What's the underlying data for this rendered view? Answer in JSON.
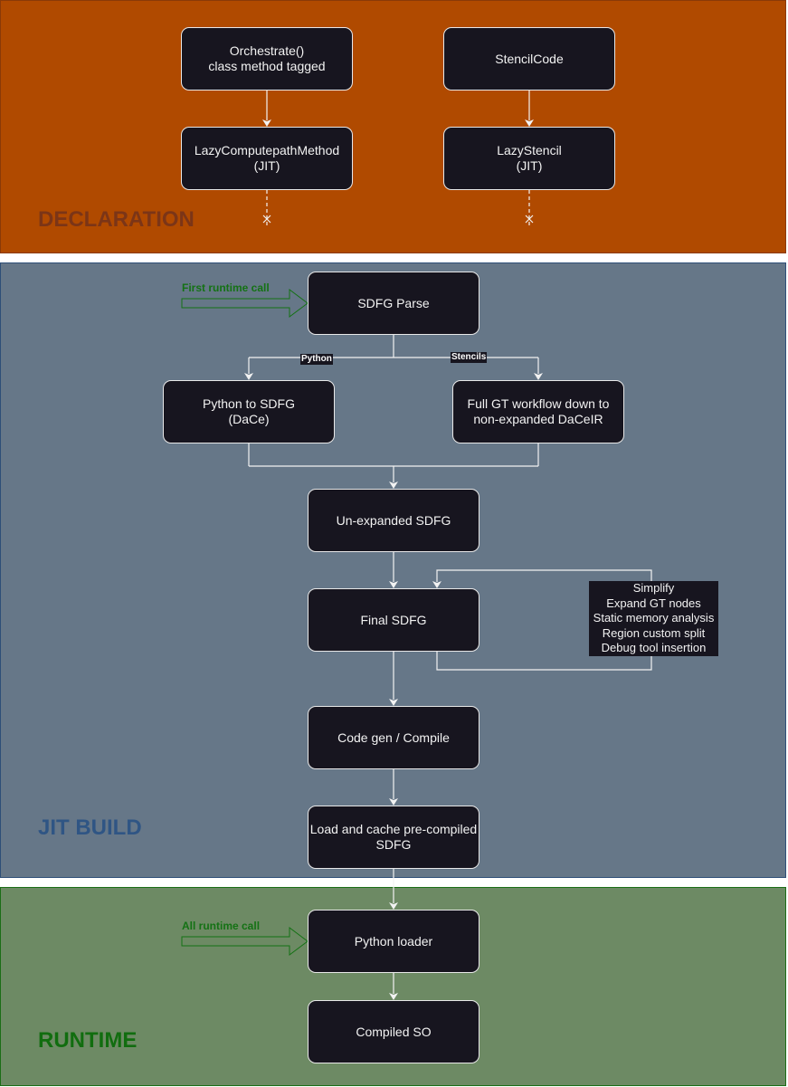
{
  "stages": {
    "declaration": "DECLARATION",
    "jit_build": "JIT BUILD",
    "runtime": "RUNTIME"
  },
  "colors": {
    "declaration_bg": "#b04a00",
    "jit_build_bg": "#667788",
    "runtime_bg": "#6d8a64",
    "node_bg": "#17151f",
    "call_arrow": "#147214"
  },
  "nodes": {
    "orchestrate": "Orchestrate()\nclass method tagged",
    "stencil_code": "StencilCode",
    "lazy_computepath": "LazyComputepathMethod\n(JIT)",
    "lazy_stencil": "LazyStencil\n(JIT)",
    "sdfg_parse": "SDFG Parse",
    "python_to_sdfg": "Python to SDFG\n(DaCe)",
    "full_gt_workflow": "Full GT workflow down to\nnon-expanded DaCeIR",
    "unexpanded_sdfg": "Un-expanded SDFG",
    "final_sdfg": "Final SDFG",
    "codegen_compile": "Code gen / Compile",
    "load_cache": "Load and cache pre-compiled\nSDFG",
    "python_loader": "Python loader",
    "compiled_so": "Compiled SO"
  },
  "edge_labels": {
    "python": "Python",
    "stencils": "Stencils"
  },
  "passes_note": "Simplify\nExpand GT nodes\nStatic memory analysis\nRegion custom split\nDebug tool insertion",
  "calls": {
    "first_runtime_call": "First runtime call",
    "all_runtime_call": "All runtime call"
  }
}
